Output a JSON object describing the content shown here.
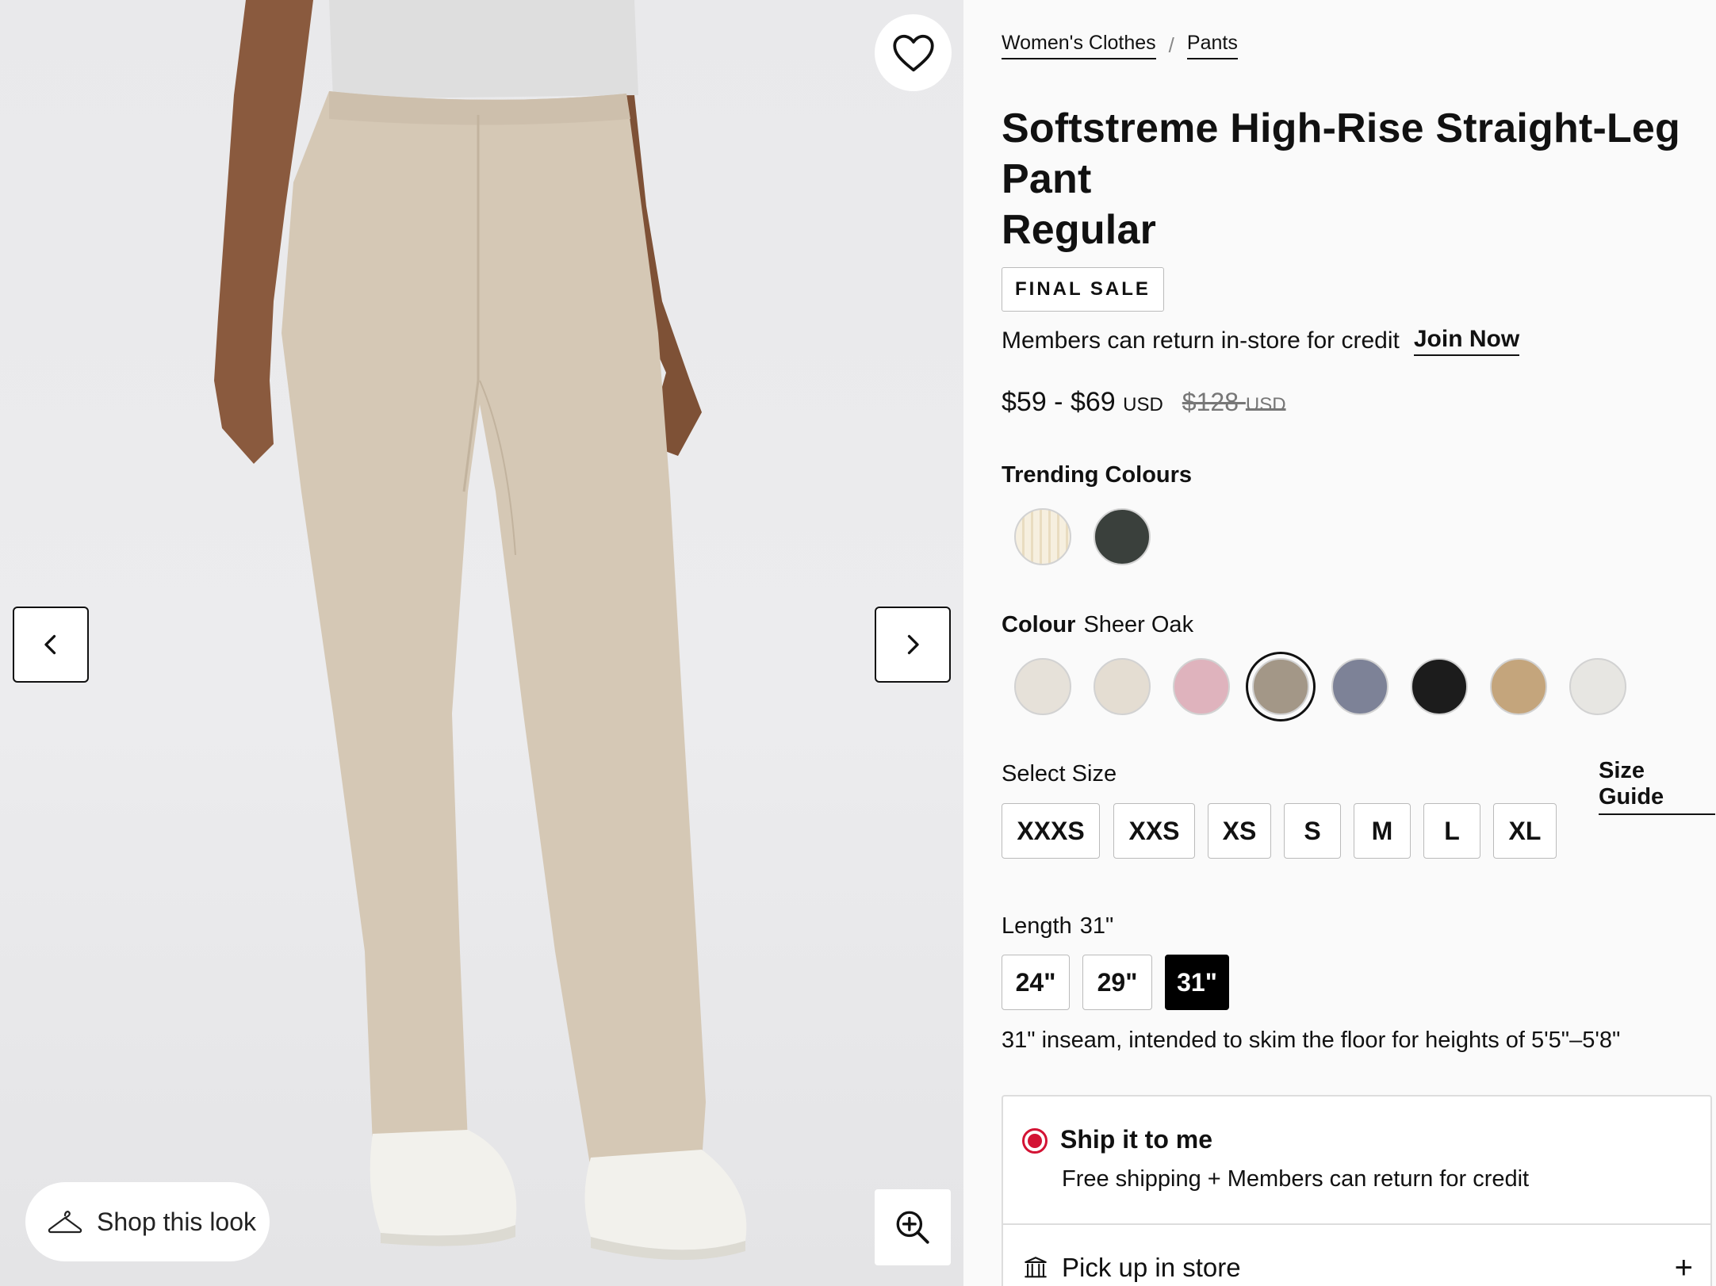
{
  "gallery": {
    "shop_look_label": "Shop this look"
  },
  "breadcrumb": [
    {
      "label": "Women's Clothes"
    },
    {
      "label": "Pants"
    }
  ],
  "breadcrumb_separator": "/",
  "product": {
    "title_line1": "Softstreme High-Rise Straight-Leg Pant",
    "title_line2": "Regular",
    "badge": "FINAL SALE",
    "member_text": "Members can return in-store for credit",
    "join_label": "Join Now",
    "price_now": "$59 - $69",
    "price_now_currency": "USD",
    "price_was": "$128",
    "price_was_currency": "USD"
  },
  "trending": {
    "label": "Trending Colours",
    "swatches": [
      {
        "name": "cream-stripe",
        "color": "#f3ead7"
      },
      {
        "name": "dark-green",
        "color": "#3a403c"
      }
    ]
  },
  "colour": {
    "label": "Colour",
    "selected": "Sheer Oak",
    "swatches": [
      {
        "color": "#e6e1d9"
      },
      {
        "color": "#e4ddd2"
      },
      {
        "color": "#dfb3bd"
      },
      {
        "color": "#a39787"
      },
      {
        "color": "#7d8297"
      },
      {
        "color": "#1c1c1c"
      },
      {
        "color": "#c4a57c"
      },
      {
        "color": "#e7e6e2"
      }
    ],
    "selected_index": 3
  },
  "size": {
    "label": "Select Size",
    "guide_label": "Size Guide",
    "options": [
      "XXXS",
      "XXS",
      "XS",
      "S",
      "M",
      "L",
      "XL"
    ]
  },
  "length": {
    "label": "Length",
    "selected": "31\"",
    "options": [
      "24\"",
      "29\"",
      "31\""
    ],
    "selected_index": 2,
    "inseam_note": "31\" inseam, intended to skim the floor for heights of 5'5\"–5'8\""
  },
  "shipping": {
    "ship_title": "Ship it to me",
    "ship_sub": "Free shipping + Members can return for credit",
    "pickup_label": "Pick up in store",
    "accent": "#d31334"
  }
}
